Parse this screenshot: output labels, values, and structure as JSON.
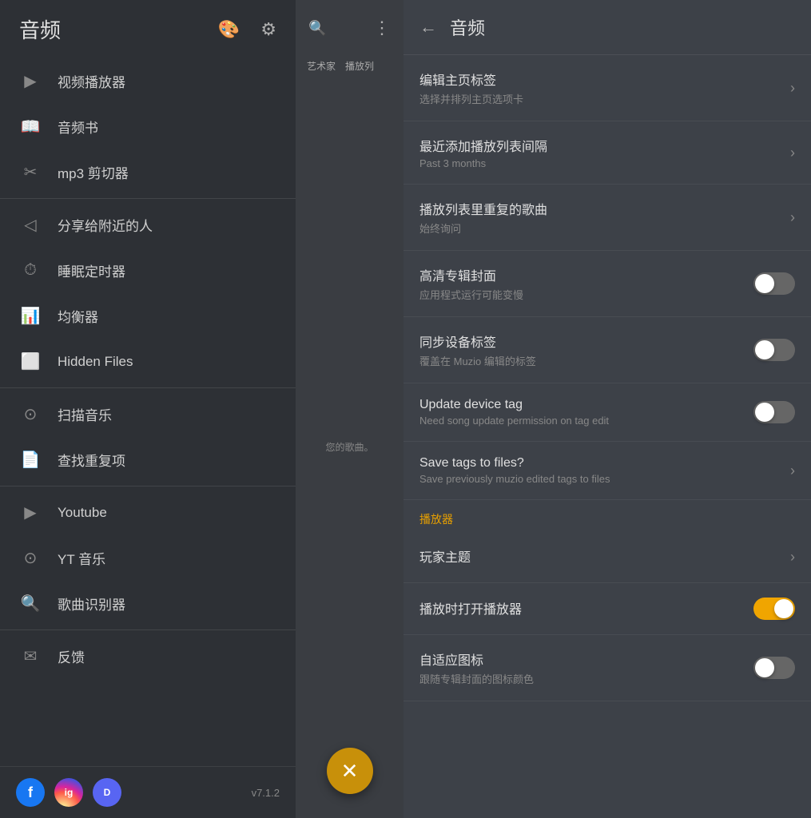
{
  "sidebar": {
    "title": "音频",
    "header_icons": {
      "palette": "🎨",
      "settings": "⚙"
    },
    "menu_items": [
      {
        "id": "video-player",
        "icon": "▶",
        "label": "视频播放器",
        "divider_after": false
      },
      {
        "id": "audiobook",
        "icon": "📖",
        "label": "音频书",
        "divider_after": false
      },
      {
        "id": "mp3-cutter",
        "icon": "✂",
        "label": "mp3 剪切器",
        "divider_after": true
      },
      {
        "id": "share-nearby",
        "icon": "◁",
        "label": "分享给附近的人",
        "divider_after": false
      },
      {
        "id": "sleep-timer",
        "icon": "⏱",
        "label": "睡眠定时器",
        "divider_after": false
      },
      {
        "id": "equalizer",
        "icon": "📊",
        "label": "均衡器",
        "divider_after": false
      },
      {
        "id": "hidden-files",
        "icon": "⬜",
        "label": "Hidden Files",
        "divider_after": true
      },
      {
        "id": "scan-music",
        "icon": "⊙",
        "label": "扫描音乐",
        "divider_after": false
      },
      {
        "id": "find-duplicates",
        "icon": "📄",
        "label": "查找重复项",
        "divider_after": true
      },
      {
        "id": "youtube",
        "icon": "▶",
        "label": "Youtube",
        "divider_after": false
      },
      {
        "id": "yt-music",
        "icon": "⊙",
        "label": "YT 音乐",
        "divider_after": false
      },
      {
        "id": "song-recognizer",
        "icon": "🔍",
        "label": "歌曲识别器",
        "divider_after": true
      },
      {
        "id": "feedback",
        "icon": "✉",
        "label": "反馈",
        "divider_after": false
      }
    ],
    "footer": {
      "social": [
        {
          "id": "facebook",
          "label": "f",
          "color": "fb"
        },
        {
          "id": "instagram",
          "label": "ig",
          "color": "ig"
        },
        {
          "id": "discord",
          "label": "d",
          "color": "discord"
        }
      ],
      "version": "v7.1.2"
    }
  },
  "middle": {
    "search_icon": "🔍",
    "more_icon": "⋮",
    "tabs": [
      "艺术家",
      "播放列"
    ],
    "empty_text": "您的歌曲。",
    "fab_icon": "✕"
  },
  "settings": {
    "back_icon": "←",
    "title": "音频",
    "items": [
      {
        "id": "edit-home-tabs",
        "title": "编辑主页标签",
        "subtitle": "选择并排列主页选项卡",
        "type": "arrow"
      },
      {
        "id": "recently-added-interval",
        "title": "最近添加播放列表间隔",
        "subtitle": "Past 3 months",
        "type": "arrow"
      },
      {
        "id": "playlist-duplicates",
        "title": "播放列表里重复的歌曲",
        "subtitle": "始终询问",
        "type": "arrow"
      },
      {
        "id": "hd-album-art",
        "title": "高清专辑封面",
        "subtitle": "应用程式运行可能变慢",
        "type": "toggle",
        "value": false
      },
      {
        "id": "sync-device-tags",
        "title": "同步设备标签",
        "subtitle": "覆盖在 Muzio 编辑的标签",
        "type": "toggle",
        "value": false
      },
      {
        "id": "update-device-tag",
        "title": "Update device tag",
        "subtitle": "Need song update permission on tag edit",
        "type": "toggle",
        "value": false
      },
      {
        "id": "save-tags-to-files",
        "title": "Save tags to files?",
        "subtitle": "Save previously muzio edited tags to files",
        "type": "arrow"
      }
    ],
    "section_player": "播放器",
    "player_items": [
      {
        "id": "player-theme",
        "title": "玩家主题",
        "subtitle": "",
        "type": "arrow"
      },
      {
        "id": "open-player-on-play",
        "title": "播放时打开播放器",
        "subtitle": "",
        "type": "toggle",
        "value": true
      },
      {
        "id": "adaptive-icon",
        "title": "自适应图标",
        "subtitle": "跟随专辑封面的图标颜色",
        "type": "toggle",
        "value": false
      }
    ]
  }
}
